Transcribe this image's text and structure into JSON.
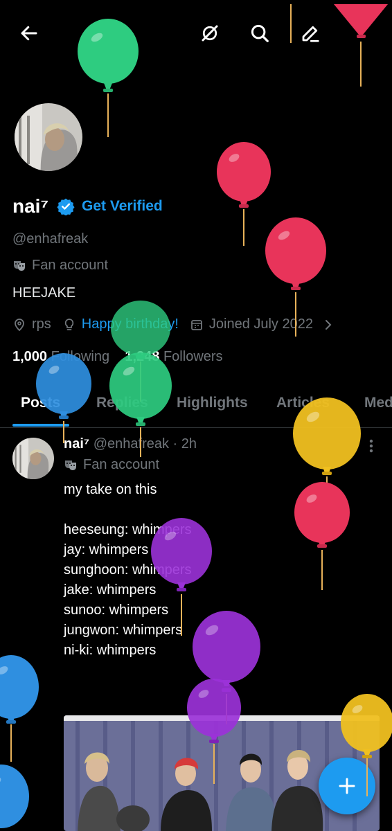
{
  "topbar": {
    "back_icon": "arrow-left-icon",
    "grok_icon": "grok-icon",
    "search_icon": "search-icon",
    "edit_icon": "edit-pencil-icon"
  },
  "profile": {
    "name": "nai⁷",
    "get_verified": "Get Verified",
    "handle": "@enhafreak",
    "label": "Fan account",
    "bio": "HEEJAKE",
    "location": "rps",
    "website": "Happy birthday!",
    "joined": "Joined July 2022",
    "following_count": "1,000",
    "following_label": "Following",
    "followers_count": "1,248",
    "followers_label": "Followers"
  },
  "tabs": [
    {
      "label": "Posts",
      "active": true
    },
    {
      "label": "Replies",
      "active": false
    },
    {
      "label": "Highlights",
      "active": false
    },
    {
      "label": "Articles",
      "active": false
    },
    {
      "label": "Media",
      "active": false
    }
  ],
  "post": {
    "name": "nai⁷",
    "handle": "@enhafreak",
    "time": "· 2h",
    "label": "Fan account",
    "lines": [
      "my take on this",
      "",
      "heeseung: whimpers",
      "jay: whimpers",
      "sunghoon: whimpers",
      "jake: whimpers",
      "sunoo: whimpers",
      "jungwon: whimpers",
      "ni-ki: whimpers"
    ]
  },
  "fab": {
    "icon": "plus-icon"
  },
  "colors": {
    "accent": "#1d9bf0",
    "balloon_green": "#2ecc80",
    "balloon_red": "#e8345a",
    "balloon_blue": "#2f8fe0",
    "balloon_yellow": "#f0c020",
    "balloon_purple": "#9b32d8"
  }
}
